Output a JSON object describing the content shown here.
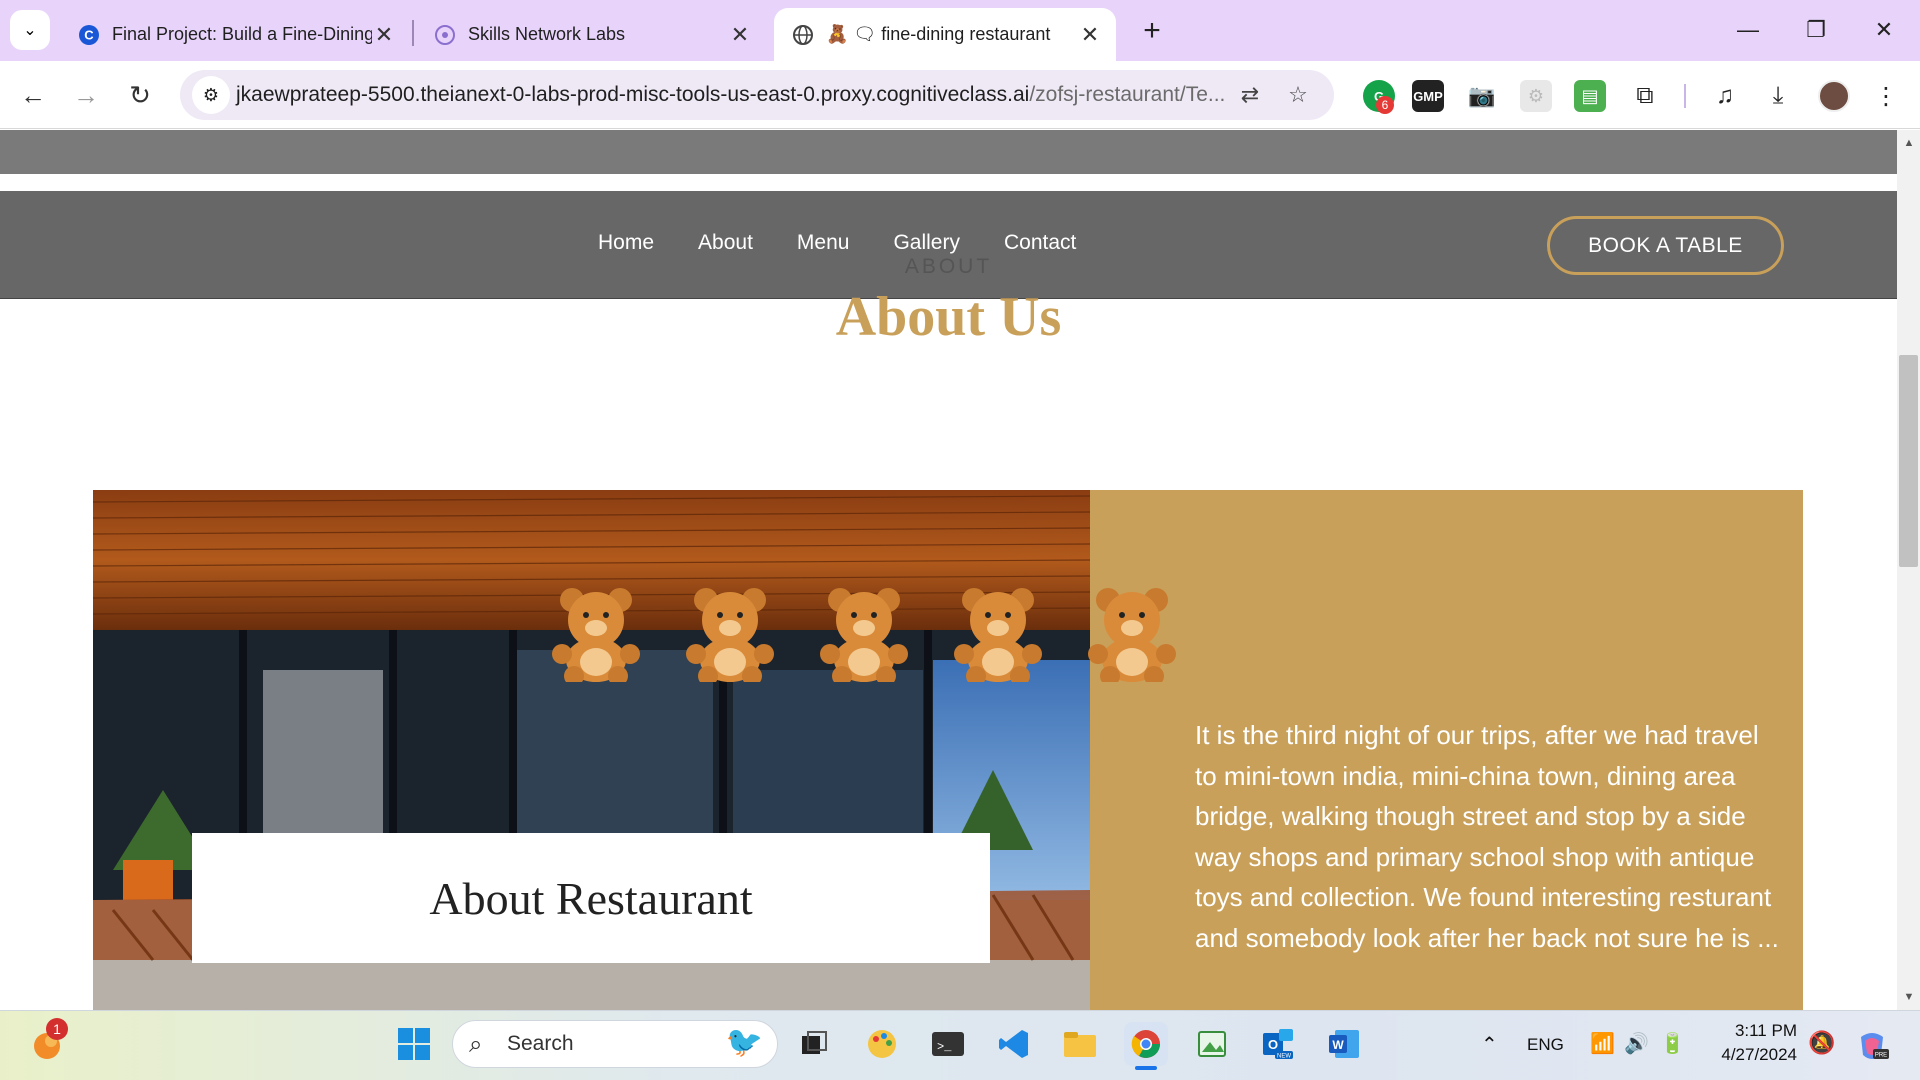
{
  "browser": {
    "tabs": [
      {
        "title": "Final Project: Build a Fine-Dining",
        "favicon": "coursera-icon"
      },
      {
        "title": "Skills Network Labs",
        "favicon": "skills-network-icon"
      },
      {
        "title": "🧸 🗨 fine-dining restaurant",
        "favicon": "globe-icon",
        "active": true
      }
    ],
    "url_host": "jkaewprateep-5500.theianext-0-labs-prod-misc-tools-us-east-0.proxy.cognitiveclass.ai",
    "url_path": "/zofsj-restaurant/Te...",
    "extension_badge": "6",
    "extensions": [
      "grammarly-icon",
      "gmp-icon",
      "camera-icon",
      "settings-ghost-icon",
      "printer-icon",
      "puzzle-icon",
      "media-icon",
      "download-icon",
      "profile-avatar"
    ]
  },
  "site": {
    "nav": [
      "Home",
      "About",
      "Menu",
      "Gallery",
      "Contact"
    ],
    "book_button": "BOOK A TABLE",
    "about_kicker": "ABOUT",
    "about_title": "About Us",
    "card_title": "About Restaurant",
    "description": "It is the third night of our trips, after we had travel to mini-town india, mini-china town, dining area bridge, walking though street and stop by a side way shops and primary school shop with antique toys and collection. We found interesting resturant and somebody look after her back not sure he is ...",
    "accent_color": "#c9a05a",
    "nav_bg": "#676767"
  },
  "taskbar": {
    "search_placeholder": "Search",
    "notification_badge": "1",
    "language": "ENG",
    "time": "3:11 PM",
    "date": "4/27/2024"
  }
}
